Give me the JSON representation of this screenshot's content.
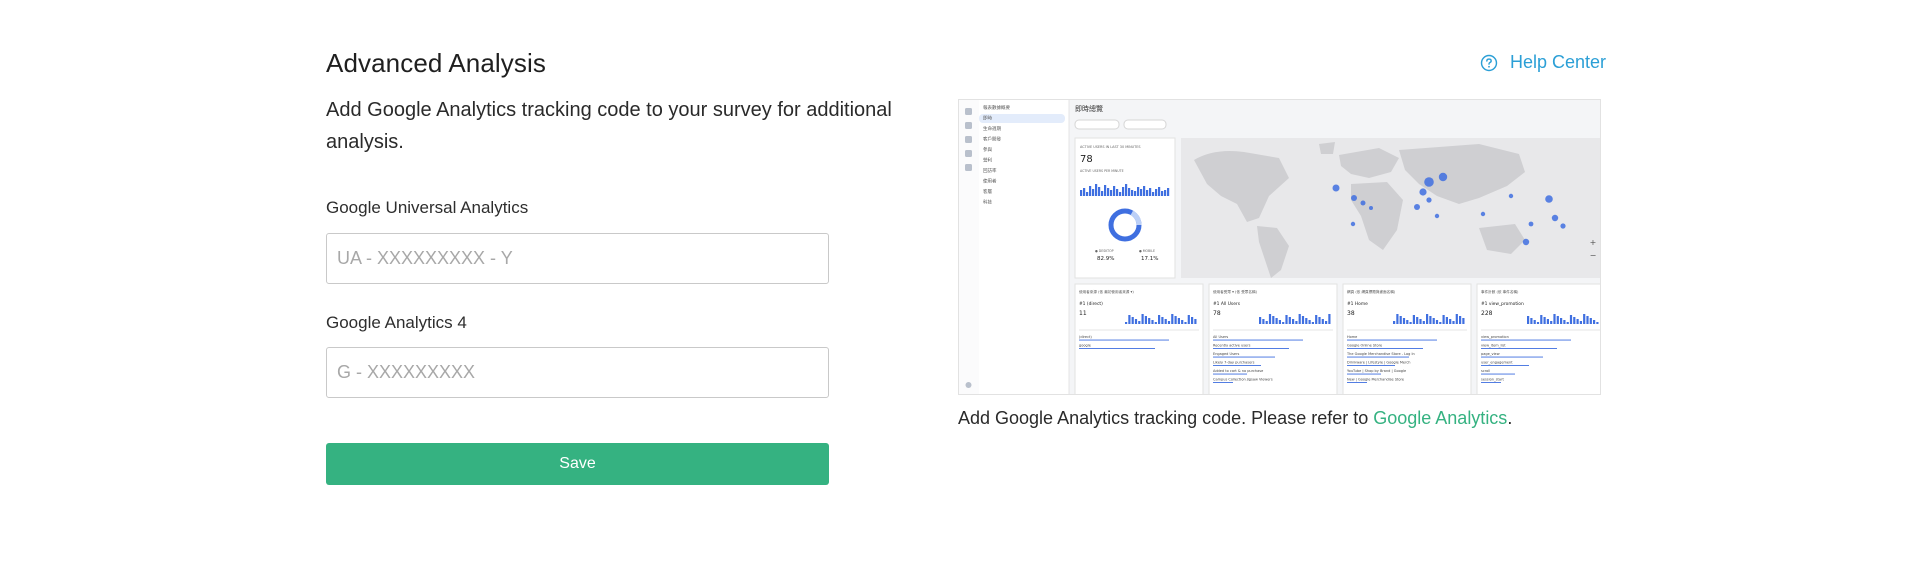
{
  "header": {
    "title": "Advanced Analysis",
    "help_label": "Help Center",
    "help_icon": "question-circle-icon"
  },
  "intro": {
    "description": "Add Google Analytics tracking code to your survey for additional analysis."
  },
  "form": {
    "ua": {
      "label": "Google Universal Analytics",
      "value": "",
      "placeholder": "UA - XXXXXXXXX - Y"
    },
    "ga4": {
      "label": "Google Analytics 4",
      "value": "",
      "placeholder": "G - XXXXXXXXX"
    },
    "save_label": "Save"
  },
  "preview": {
    "caption_prefix": "Add Google Analytics tracking code. Please refer to ",
    "caption_link": "Google Analytics",
    "caption_suffix": ".",
    "sidebar_items": [
      "報表數據概要",
      "即時",
      "生命週期",
      "客戶開發",
      "參與",
      "營利",
      "回訪率",
      "使用者",
      "客層",
      "科技"
    ],
    "realtime": {
      "header": "即時總覽",
      "active_users_label": "ACTIVE USERS IN LAST 30 MINUTES",
      "active_users": "78",
      "per_minute_label": "ACTIVE USERS PER MINUTE",
      "desktop_pct": "82.9%",
      "mobile_pct": "17.1%",
      "desktop_label": "● DESKTOP",
      "mobile_label": "● MOBILE"
    },
    "cards": [
      {
        "title": "使用者來源 (依 最初使用者來源 ▾)",
        "top": "#1 (direct)",
        "value": "11",
        "rows": [
          "(direct)",
          "google"
        ]
      },
      {
        "title": "使用者受眾 ▾ (依 受眾名稱)",
        "top": "#1 All Users",
        "value": "78",
        "rows": [
          "All Users",
          "Recently active users",
          "Engaged Users",
          "Likely 7-day purchasers",
          "Added to cart & no purchase",
          "Campus Collection Jigsaw Viewers"
        ]
      },
      {
        "title": "網頁 (依 網頁標題與畫面名稱)",
        "top": "#1 Home",
        "value": "38",
        "rows": [
          "Home",
          "Google Online Store",
          "The Google Merchandise Store - Log In",
          "Drinkware | Lifestyle | Google Merch",
          "YouTube | Shop by Brand | Google",
          "New | Google Merchandise Store"
        ]
      },
      {
        "title": "事件計數 (依 事件名稱)",
        "top": "#1 view_promotion",
        "value": "228",
        "rows": [
          "view_promotion",
          "view_item_list",
          "page_view",
          "user_engagement",
          "scroll",
          "session_start"
        ]
      }
    ],
    "colors": {
      "accent": "#35b281",
      "link_blue": "#2b9fd6",
      "map_bubble": "#3f6fe0"
    }
  }
}
